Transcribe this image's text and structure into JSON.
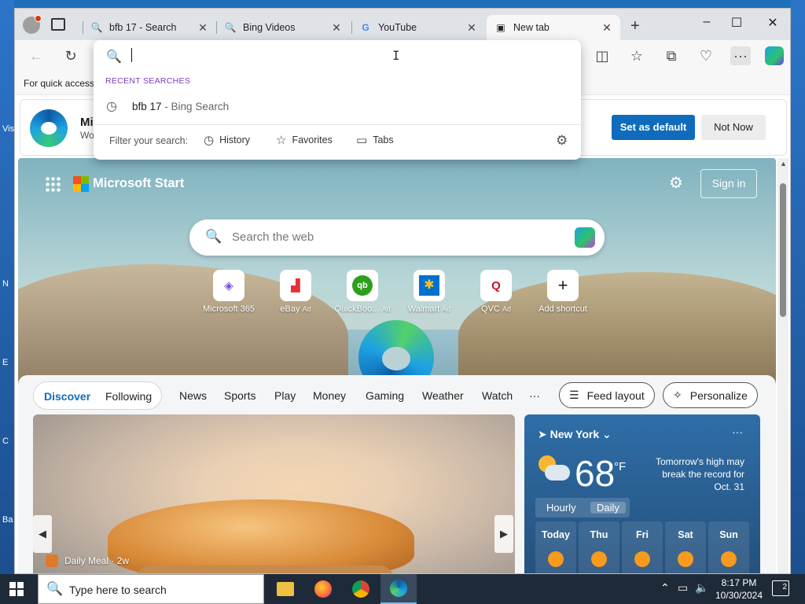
{
  "desktop": {
    "left_labels": [
      "Vis",
      "N",
      "E",
      "C",
      "Ba"
    ]
  },
  "tabs": [
    {
      "title": "bfb 17 - Search",
      "icon": "search-icon"
    },
    {
      "title": "Bing Videos",
      "icon": "search-icon"
    },
    {
      "title": "YouTube",
      "icon": "google-icon"
    },
    {
      "title": "New tab",
      "icon": "newtab-page-icon"
    }
  ],
  "favbar": {
    "text": "For quick access"
  },
  "default_bar": {
    "title": "Mi",
    "subtitle": "Wo",
    "set_default": "Set as default",
    "not_now": "Not Now"
  },
  "omnibox": {
    "recent_label": "RECENT SEARCHES",
    "recent_query": "bfb 17",
    "recent_source": " - Bing Search",
    "filter_label": "Filter your search:",
    "chips": [
      "History",
      "Favorites",
      "Tabs"
    ]
  },
  "ntp": {
    "brand": "Microsoft Start",
    "sign_in": "Sign in",
    "search_placeholder": "Search the web",
    "shortcuts": [
      {
        "label": "Microsoft 365",
        "ad": ""
      },
      {
        "label": "eBay",
        "ad": "Ad"
      },
      {
        "label": "QuickBoo...",
        "ad": "Ad"
      },
      {
        "label": "Walmart",
        "ad": "Ad"
      },
      {
        "label": "QVC",
        "ad": "Ad"
      },
      {
        "label": "Add shortcut",
        "ad": ""
      }
    ]
  },
  "feed": {
    "pill_discover": "Discover",
    "pill_following": "Following",
    "categories": [
      "News",
      "Sports",
      "Play",
      "Money",
      "Gaming",
      "Weather",
      "Watch",
      "···"
    ],
    "feed_layout": "Feed layout",
    "personalize": "Personalize",
    "main_card_source": "Daily Meal · 2w"
  },
  "weather": {
    "location": "New York",
    "temp": "68",
    "unit": "°F",
    "alert": "Tomorrow's high may break the record for Oct. 31",
    "tab_hourly": "Hourly",
    "tab_daily": "Daily",
    "days": [
      "Today",
      "Thu",
      "Fri",
      "Sat",
      "Sun"
    ]
  },
  "taskbar": {
    "search_placeholder": "Type here to search",
    "time": "8:17 PM",
    "date": "10/30/2024",
    "notification_count": "2"
  },
  "colors": {
    "accent": "#0f6cbd",
    "taskbar": "#1f2a38",
    "weather_card": "#2e6ea8"
  }
}
